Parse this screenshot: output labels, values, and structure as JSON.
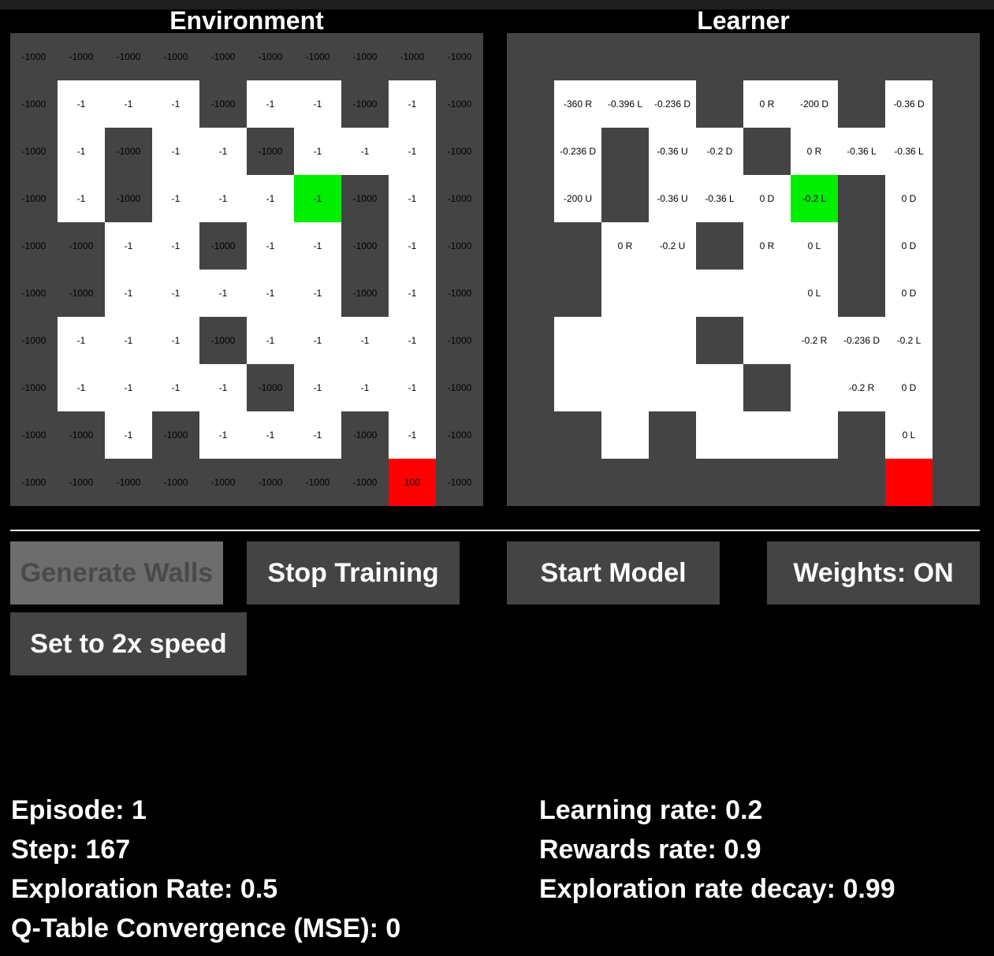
{
  "panels": {
    "environment_title": "Environment",
    "learner_title": "Learner"
  },
  "environment_grid": [
    [
      "-1000",
      "-1000",
      "-1000",
      "-1000",
      "-1000",
      "-1000",
      "-1000",
      "-1000",
      "-1000",
      "-1000"
    ],
    [
      "-1000",
      "-1",
      "-1",
      "-1",
      "-1000",
      "-1",
      "-1",
      "-1000",
      "-1",
      "-1000"
    ],
    [
      "-1000",
      "-1",
      "-1000",
      "-1",
      "-1",
      "-1000",
      "-1",
      "-1",
      "-1",
      "-1000"
    ],
    [
      "-1000",
      "-1",
      "-1000",
      "-1",
      "-1",
      "-1",
      "-1",
      "-1000",
      "-1",
      "-1000"
    ],
    [
      "-1000",
      "-1000",
      "-1",
      "-1",
      "-1000",
      "-1",
      "-1",
      "-1000",
      "-1",
      "-1000"
    ],
    [
      "-1000",
      "-1000",
      "-1",
      "-1",
      "-1",
      "-1",
      "-1",
      "-1000",
      "-1",
      "-1000"
    ],
    [
      "-1000",
      "-1",
      "-1",
      "-1",
      "-1000",
      "-1",
      "-1",
      "-1",
      "-1",
      "-1000"
    ],
    [
      "-1000",
      "-1",
      "-1",
      "-1",
      "-1",
      "-1000",
      "-1",
      "-1",
      "-1",
      "-1000"
    ],
    [
      "-1000",
      "-1000",
      "-1",
      "-1000",
      "-1",
      "-1",
      "-1",
      "-1000",
      "-1",
      "-1000"
    ],
    [
      "-1000",
      "-1000",
      "-1000",
      "-1000",
      "-1000",
      "-1000",
      "-1000",
      "-1000",
      "100",
      "-1000"
    ]
  ],
  "learner_grid": [
    [
      "",
      "",
      "",
      "",
      "",
      "",
      "",
      "",
      "",
      ""
    ],
    [
      "",
      "-360 R",
      "-0.396 L",
      "-0.236 D",
      "",
      "0 R",
      "-200 D",
      "",
      "-0.36 D",
      ""
    ],
    [
      "",
      "-0.236 D",
      "",
      "-0.36 U",
      "-0.2 D",
      "",
      "0 R",
      "-0.36 L",
      "-0.36 L",
      ""
    ],
    [
      "",
      "-200 U",
      "",
      "-0.36 U",
      "-0.36 L",
      "0 D",
      "-0.2 L",
      "",
      "0 D",
      ""
    ],
    [
      "",
      "",
      "0 R",
      "-0.2 U",
      "",
      "0 R",
      "0 L",
      "",
      "0 D",
      ""
    ],
    [
      "",
      "",
      "",
      "",
      "",
      "",
      "0 L",
      "",
      "0 D",
      ""
    ],
    [
      "",
      "",
      "",
      "",
      "",
      "",
      "-0.2 R",
      "-0.236 D",
      "-0.2 L",
      ""
    ],
    [
      "",
      "",
      "",
      "",
      "",
      "",
      "",
      "-0.2 R",
      "0 D",
      ""
    ],
    [
      "",
      "",
      "",
      "",
      "",
      "",
      "",
      "",
      "0 L",
      ""
    ],
    [
      "",
      "",
      "",
      "",
      "",
      "",
      "",
      "",
      "",
      ""
    ]
  ],
  "agent_position": {
    "row": 3,
    "col": 6
  },
  "goal_position": {
    "row": 9,
    "col": 8
  },
  "colors": {
    "wall": "#444444",
    "open": "#ffffff",
    "agent": "#00ee00",
    "goal": "#ff0000",
    "button": "#444444",
    "button_disabled": "#6d6d6d"
  },
  "buttons": {
    "generate_walls": "Generate Walls",
    "stop_training": "Stop Training",
    "start_model": "Start Model",
    "weights": "Weights: ON",
    "speed": "Set to 2x speed"
  },
  "stats": {
    "episode": "Episode: 1",
    "step": "Step: 167",
    "exploration_rate": "Exploration Rate: 0.5",
    "convergence": "Q-Table Convergence (MSE): 0",
    "learning_rate": "Learning rate: 0.2",
    "rewards_rate": "Rewards rate: 0.9",
    "exploration_decay": "Exploration rate decay: 0.99"
  }
}
